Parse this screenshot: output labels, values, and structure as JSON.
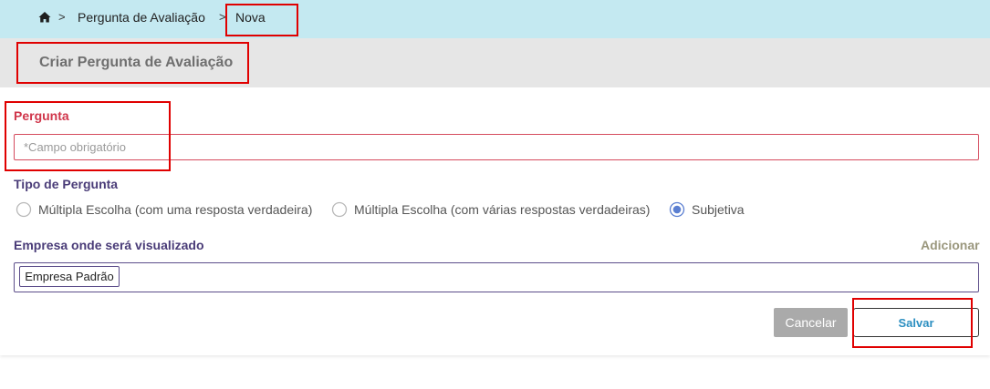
{
  "breadcrumb": {
    "home_icon": "home-icon",
    "separator": ">",
    "items": [
      "Pergunta de Avaliação",
      "Nova"
    ]
  },
  "page": {
    "title": "Criar Pergunta de Avaliação"
  },
  "form": {
    "pergunta": {
      "label": "Pergunta",
      "value": "",
      "placeholder": "*Campo obrigatório"
    },
    "tipo": {
      "label": "Tipo de Pergunta",
      "options": [
        {
          "label": "Múltipla Escolha (com uma resposta verdadeira)",
          "selected": false
        },
        {
          "label": "Múltipla Escolha (com várias respostas verdadeiras)",
          "selected": false
        },
        {
          "label": "Subjetiva",
          "selected": true
        }
      ]
    },
    "empresa": {
      "label": "Empresa onde será visualizado",
      "add_label": "Adicionar",
      "tags": [
        "Empresa Padrão"
      ]
    }
  },
  "actions": {
    "cancel_label": "Cancelar",
    "save_label": "Salvar"
  },
  "colors": {
    "breadcrumb_bg": "#c4e9f1",
    "header_bg": "#e6e6e6",
    "required_red": "#d0364b",
    "label_purple": "#4a3c78",
    "radio_accent": "#5b7fd1",
    "save_text": "#2c8fc1",
    "highlight_red": "#e00000"
  }
}
